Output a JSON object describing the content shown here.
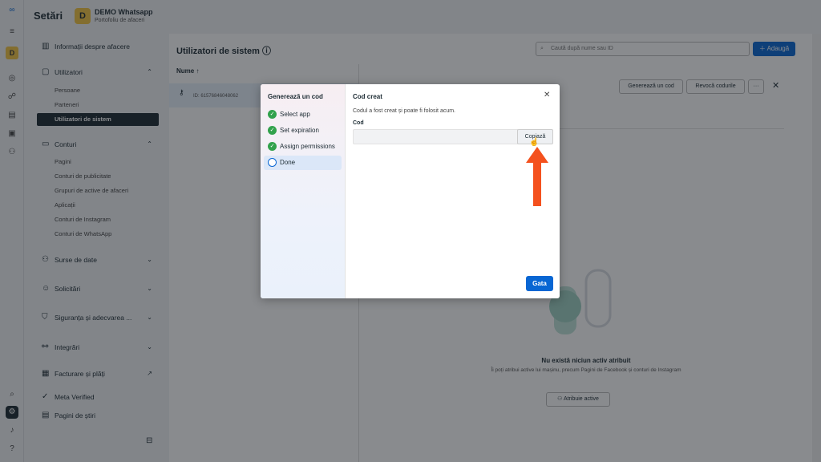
{
  "header": {
    "title": "Setări",
    "business_initial": "D",
    "business_name": "DEMO Whatsapp",
    "business_sub": "Portofoliu de afaceri"
  },
  "rail": {
    "avatar_initial": "D"
  },
  "sidebar": {
    "business_info": "Informații despre afacere",
    "users": "Utilizatori",
    "users_items": [
      "Persoane",
      "Parteneri",
      "Utilizatori de sistem"
    ],
    "accounts": "Conturi",
    "accounts_items": [
      "Pagini",
      "Conturi de publicitate",
      "Grupuri de active de afaceri",
      "Aplicații",
      "Conturi de Instagram",
      "Conturi de WhatsApp"
    ],
    "data_sources": "Surse de date",
    "requests": "Solicitări",
    "safety": "Siguranța și adecvarea ...",
    "integrations": "Integrări",
    "billing": "Facturare și plăți",
    "meta_verified": "Meta Verified",
    "news": "Pagini de știri"
  },
  "main": {
    "title": "Utilizatori de sistem",
    "search_placeholder": "Caută după nume sau ID",
    "add_label": "Adaugă",
    "column_name": "Nume",
    "row_id": "ID: 61576846048062",
    "generate_code": "Generează un cod",
    "revoke_codes": "Revocă codurile",
    "more": "···",
    "empty_title": "Nu există niciun activ atribuit",
    "empty_desc": "Îi poți atribui active lui mașinu, precum Pagini de Facebook și conturi de Instagram",
    "assign_label": "Atribuie active"
  },
  "modal": {
    "steps_title": "Generează un cod",
    "steps": [
      {
        "label": "Select app",
        "done": true
      },
      {
        "label": "Set expiration",
        "done": true
      },
      {
        "label": "Assign permissions",
        "done": true
      },
      {
        "label": "Done",
        "done": false
      }
    ],
    "title": "Cod creat",
    "description": "Codul a fost creat și poate fi folosit acum.",
    "code_label": "Cod",
    "code_value": "",
    "copy_label": "Copiază",
    "done_label": "Gata"
  },
  "colors": {
    "accent": "#0866d3",
    "check": "#31a24c",
    "arrow": "#f4511e"
  }
}
